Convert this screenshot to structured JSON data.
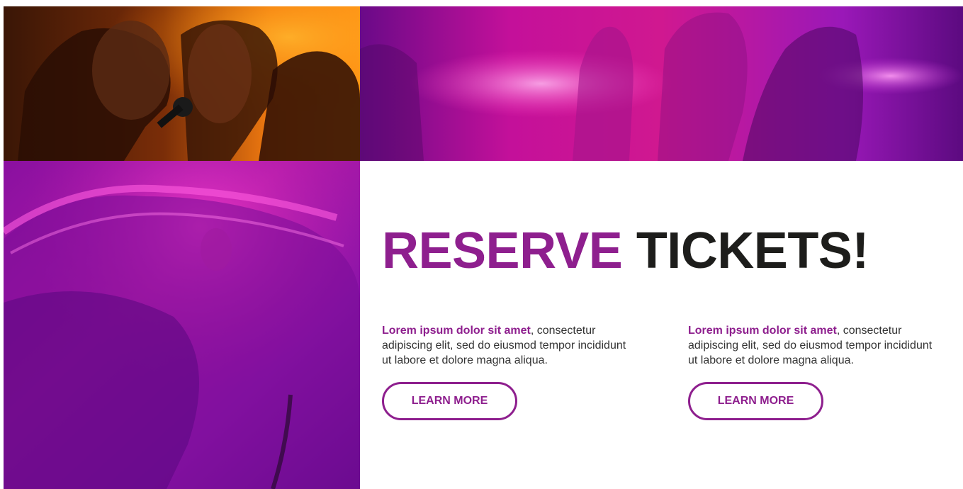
{
  "heading": {
    "accent": "RESERVE",
    "rest": "TICKETS!"
  },
  "colors": {
    "accent": "#8e1f8e",
    "dark": "#1d1d1b"
  },
  "info": [
    {
      "lead": "Lorem ipsum dolor sit amet",
      "body": ", consectetur adipiscing elit, sed do eiusmod tempor incididunt ut labore et dolore magna aliqua.",
      "button_label": "LEARN MORE"
    },
    {
      "lead": "Lorem ipsum dolor sit amet",
      "body": ", consectetur adipiscing elit, sed do eiusmod tempor incididunt ut labore et dolore magna aliqua.",
      "button_label": "LEARN MORE"
    }
  ]
}
